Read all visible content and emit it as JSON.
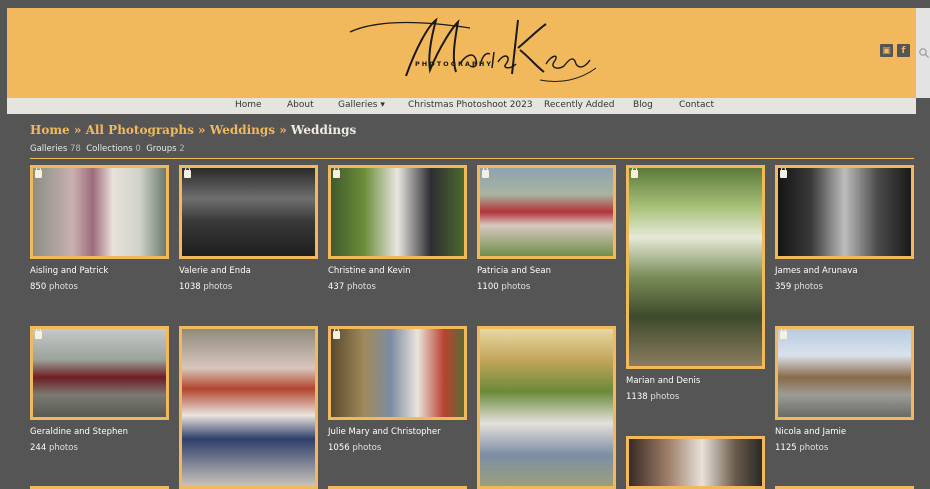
{
  "brand": {
    "logo_script": "Marie Keating",
    "logo_sub": "PHOTOGRAPHY"
  },
  "colors": {
    "accent": "#f2b95c",
    "background": "#555555",
    "nav_bg": "#e6e4de"
  },
  "social": {
    "instagram": "▣",
    "facebook": "f"
  },
  "nav": [
    {
      "label": "Home"
    },
    {
      "label": "About"
    },
    {
      "label": "Galleries ▾"
    },
    {
      "label": "Christmas Photoshoot 2023"
    },
    {
      "label": "Recently Added"
    },
    {
      "label": "Blog"
    },
    {
      "label": "Contact"
    }
  ],
  "breadcrumb": {
    "home": "Home",
    "sep": "»",
    "all": "All Photographs",
    "weddings": "Weddings",
    "current": "Weddings"
  },
  "counts": {
    "galleries_label": "Galleries",
    "galleries": "78",
    "collections_label": "Collections",
    "collections": "0",
    "groups_label": "Groups",
    "groups": "2"
  },
  "galleries": [
    {
      "title": "Aisling and Patrick",
      "count": "850",
      "unit": "photos"
    },
    {
      "title": "Valerie and Enda",
      "count": "1038",
      "unit": "photos"
    },
    {
      "title": "Christine and Kevin",
      "count": "437",
      "unit": "photos"
    },
    {
      "title": "Patricia and Sean",
      "count": "1100",
      "unit": "photos"
    },
    {
      "title": "Marian and Denis",
      "count": "1138",
      "unit": "photos"
    },
    {
      "title": "James and Arunava",
      "count": "359",
      "unit": "photos"
    },
    {
      "title": "Geraldine and Stephen",
      "count": "244",
      "unit": "photos"
    },
    {
      "title": "Julie Mary and Christopher",
      "count": "1056",
      "unit": "photos"
    },
    {
      "title": "Nicola and Jamie",
      "count": "1125",
      "unit": "photos"
    }
  ]
}
